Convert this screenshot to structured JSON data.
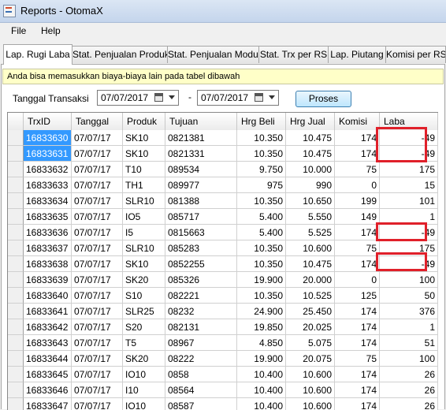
{
  "window": {
    "title": "Reports - OtomaX"
  },
  "menu": [
    "File",
    "Help"
  ],
  "tabs": [
    "Lap. Rugi Laba",
    "Stat. Penjualan Produk",
    "Stat. Penjualan Modul",
    "Stat. Trx per RS",
    "Lap. Piutang",
    "Komisi per RS"
  ],
  "info": "Anda bisa memasukkan biaya-biaya lain pada tabel dibawah",
  "filter": {
    "label": "Tanggal Transaksi",
    "date_from": "07/07/2017",
    "separator": "-",
    "date_to": "07/07/2017",
    "button": "Proses"
  },
  "grid": {
    "columns": [
      "TrxID",
      "Tanggal",
      "Produk",
      "Tujuan",
      "Hrg Beli",
      "Hrg Jual",
      "Komisi",
      "Laba"
    ],
    "rows": [
      [
        "16833630",
        "07/07/17",
        "SK10",
        "0821381",
        "10.350",
        "10.475",
        "174",
        "-49"
      ],
      [
        "16833631",
        "07/07/17",
        "SK10",
        "0821331",
        "10.350",
        "10.475",
        "174",
        "-49"
      ],
      [
        "16833632",
        "07/07/17",
        "T10",
        "089534",
        "9.750",
        "10.000",
        "75",
        "175"
      ],
      [
        "16833633",
        "07/07/17",
        "TH1",
        "089977",
        "975",
        "990",
        "0",
        "15"
      ],
      [
        "16833634",
        "07/07/17",
        "SLR10",
        "081388",
        "10.350",
        "10.650",
        "199",
        "101"
      ],
      [
        "16833635",
        "07/07/17",
        "IO5",
        "085717",
        "5.400",
        "5.550",
        "149",
        "1"
      ],
      [
        "16833636",
        "07/07/17",
        "I5",
        "0815663",
        "5.400",
        "5.525",
        "174",
        "-49"
      ],
      [
        "16833637",
        "07/07/17",
        "SLR10",
        "085283",
        "10.350",
        "10.600",
        "75",
        "175"
      ],
      [
        "16833638",
        "07/07/17",
        "SK10",
        "0852255",
        "10.350",
        "10.475",
        "174",
        "-49"
      ],
      [
        "16833639",
        "07/07/17",
        "SK20",
        "085326",
        "19.900",
        "20.000",
        "0",
        "100"
      ],
      [
        "16833640",
        "07/07/17",
        "S10",
        "082221",
        "10.350",
        "10.525",
        "125",
        "50"
      ],
      [
        "16833641",
        "07/07/17",
        "SLR25",
        "08232",
        "24.900",
        "25.450",
        "174",
        "376"
      ],
      [
        "16833642",
        "07/07/17",
        "S20",
        "082131",
        "19.850",
        "20.025",
        "174",
        "1"
      ],
      [
        "16833643",
        "07/07/17",
        "T5",
        "08967",
        "4.850",
        "5.075",
        "174",
        "51"
      ],
      [
        "16833644",
        "07/07/17",
        "SK20",
        "08222",
        "19.900",
        "20.075",
        "75",
        "100"
      ],
      [
        "16833645",
        "07/07/17",
        "IO10",
        "0858",
        "10.400",
        "10.600",
        "174",
        "26"
      ],
      [
        "16833646",
        "07/07/17",
        "I10",
        "08564",
        "10.400",
        "10.600",
        "174",
        "26"
      ],
      [
        "16833647",
        "07/07/17",
        "IO10",
        "08587",
        "10.400",
        "10.600",
        "174",
        "26"
      ]
    ]
  }
}
